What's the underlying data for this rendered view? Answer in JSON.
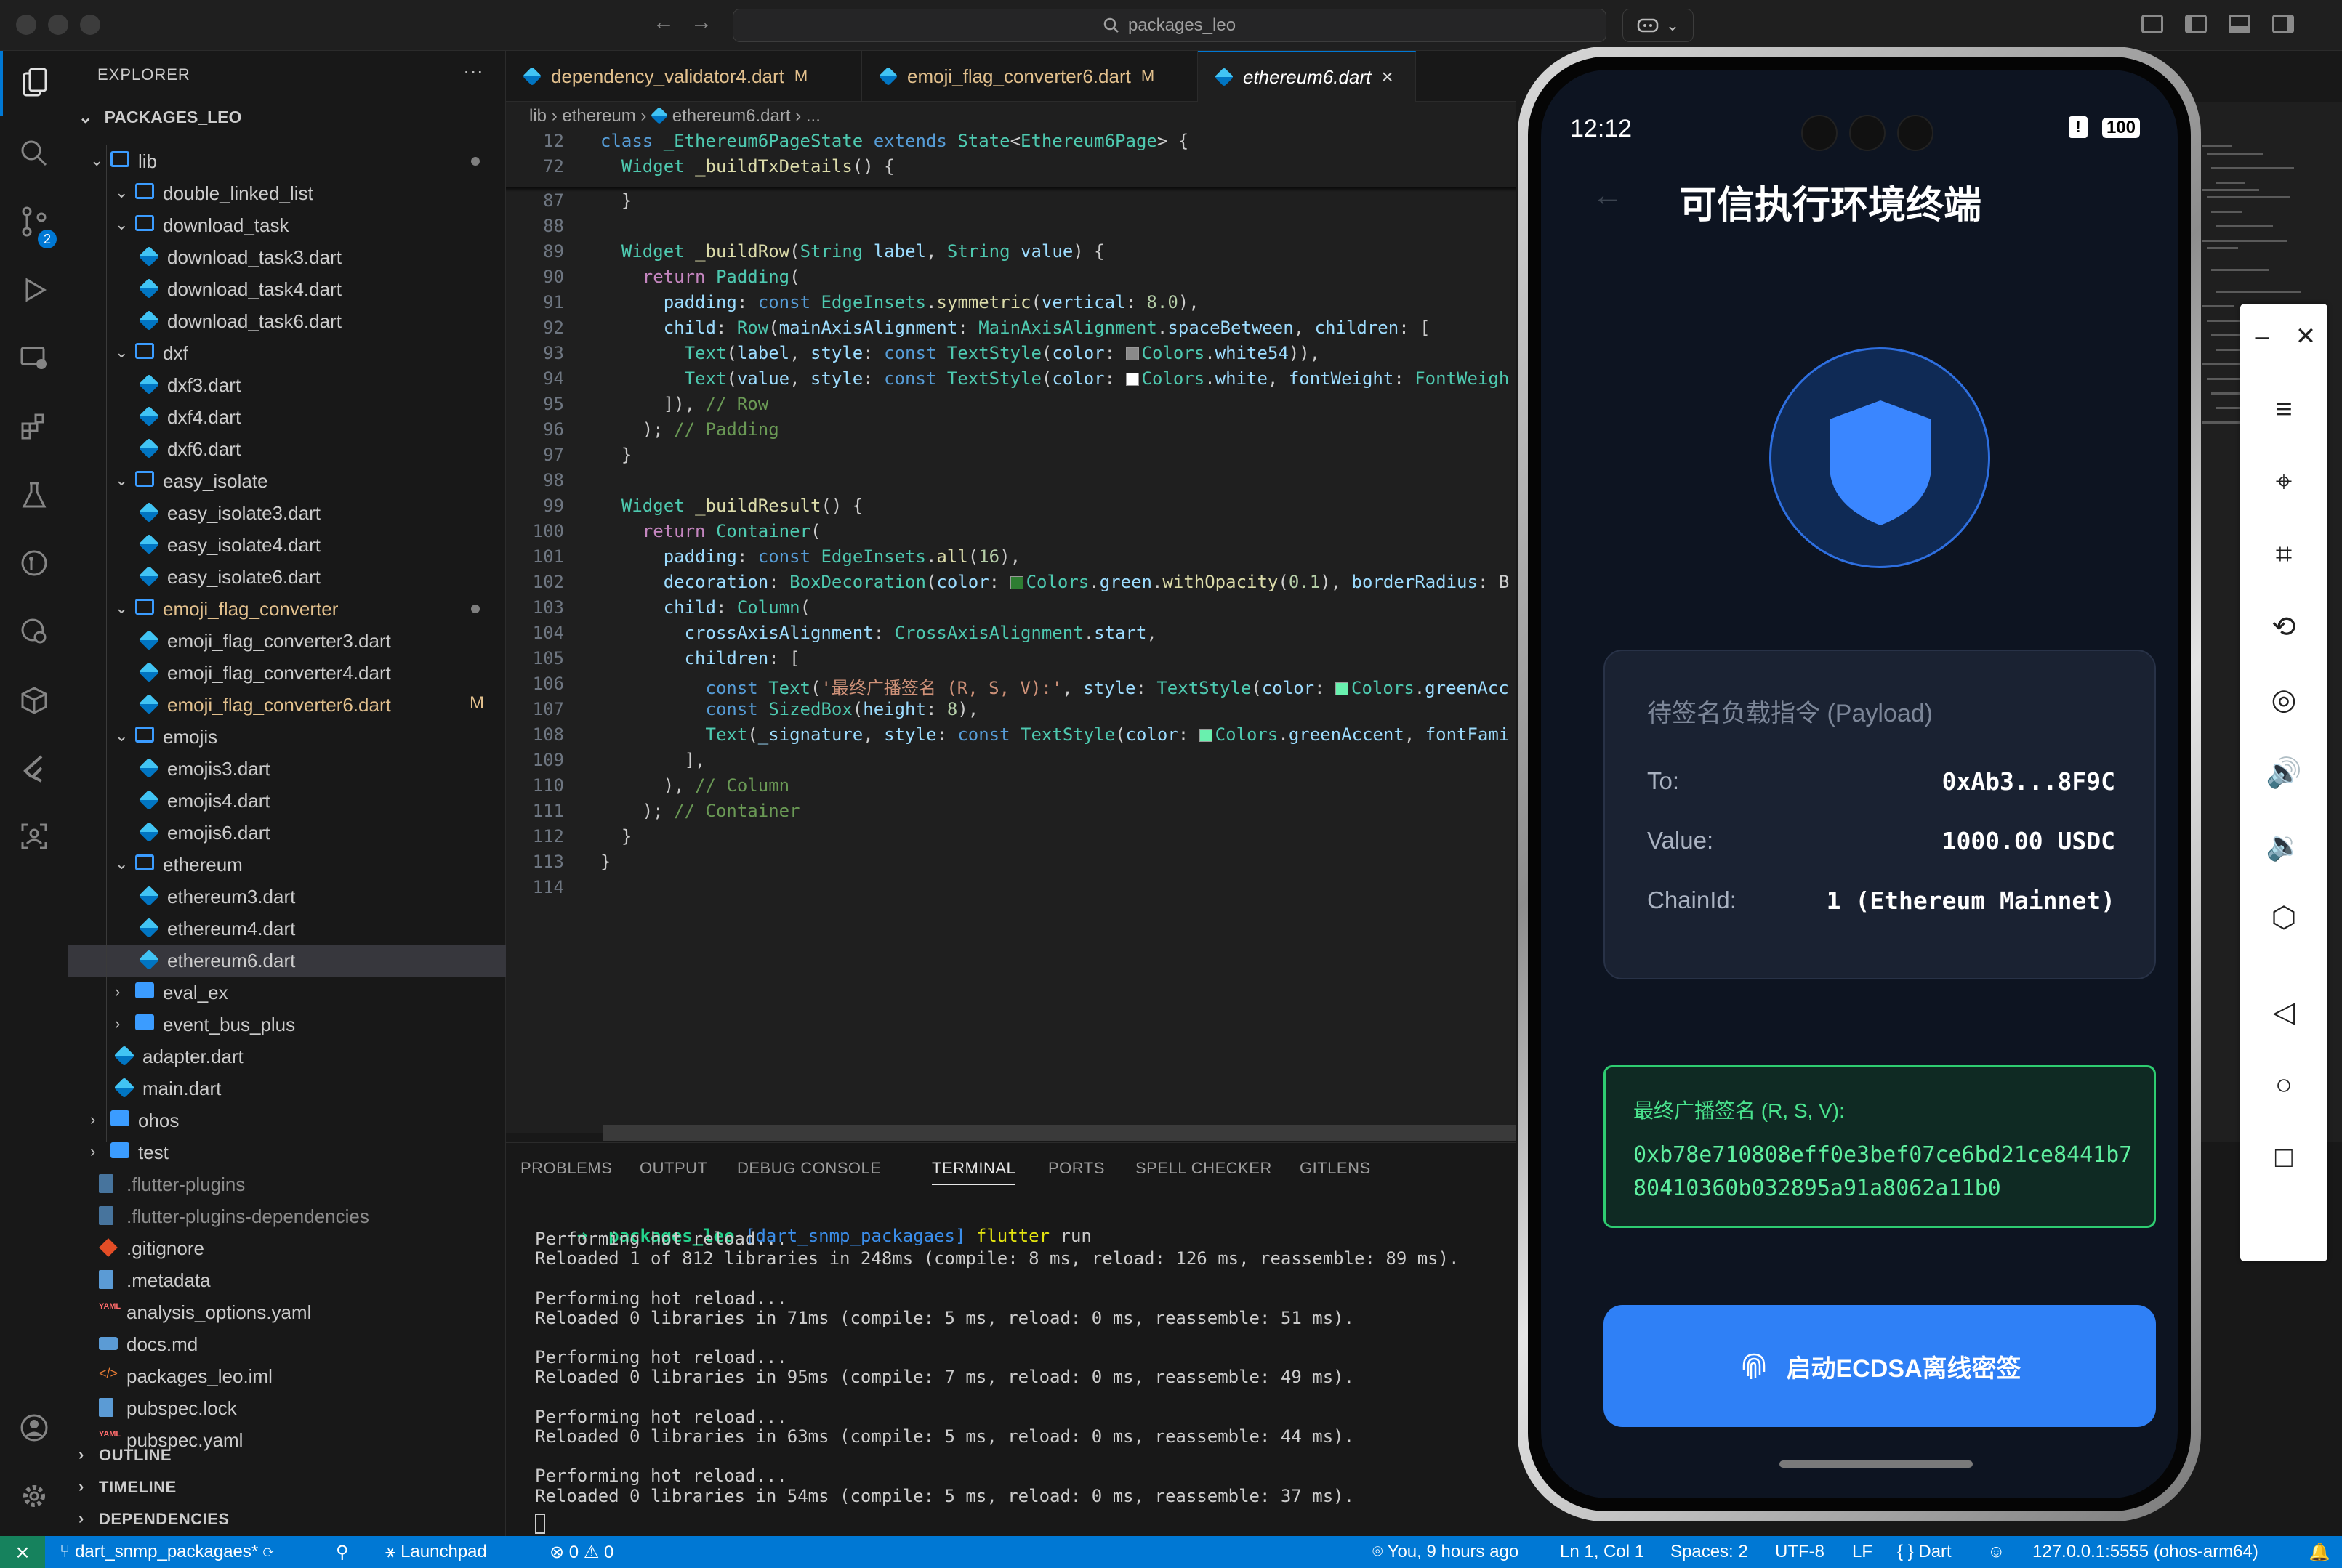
{
  "titlebar": {
    "search_text": "packages_leo",
    "back_arrow": "←",
    "forward_arrow": "→",
    "copilot_icon": "copilot-icon",
    "copilot_caret": "⌄"
  },
  "activity": {
    "scm_badge": "2"
  },
  "explorer": {
    "title": "EXPLORER",
    "more": "···",
    "root": "PACKAGES_LEO",
    "items": [
      {
        "label": "lib",
        "kind": "folder-open",
        "depth": 0,
        "chev": "⌄",
        "dot": true
      },
      {
        "label": "double_linked_list",
        "kind": "folder",
        "depth": 1,
        "chev": "⌄"
      },
      {
        "label": "download_task",
        "kind": "folder",
        "depth": 1,
        "chev": "⌄"
      },
      {
        "label": "download_task3.dart",
        "kind": "dart",
        "depth": 2
      },
      {
        "label": "download_task4.dart",
        "kind": "dart",
        "depth": 2
      },
      {
        "label": "download_task6.dart",
        "kind": "dart",
        "depth": 2
      },
      {
        "label": "dxf",
        "kind": "folder",
        "depth": 1,
        "chev": "⌄"
      },
      {
        "label": "dxf3.dart",
        "kind": "dart",
        "depth": 2
      },
      {
        "label": "dxf4.dart",
        "kind": "dart",
        "depth": 2
      },
      {
        "label": "dxf6.dart",
        "kind": "dart",
        "depth": 2
      },
      {
        "label": "easy_isolate",
        "kind": "folder",
        "depth": 1,
        "chev": "⌄"
      },
      {
        "label": "easy_isolate3.dart",
        "kind": "dart",
        "depth": 2
      },
      {
        "label": "easy_isolate4.dart",
        "kind": "dart",
        "depth": 2
      },
      {
        "label": "easy_isolate6.dart",
        "kind": "dart",
        "depth": 2
      },
      {
        "label": "emoji_flag_converter",
        "kind": "folder",
        "depth": 1,
        "chev": "⌄",
        "modified": true,
        "dot": true
      },
      {
        "label": "emoji_flag_converter3.dart",
        "kind": "dart",
        "depth": 2
      },
      {
        "label": "emoji_flag_converter4.dart",
        "kind": "dart",
        "depth": 2
      },
      {
        "label": "emoji_flag_converter6.dart",
        "kind": "dart",
        "depth": 2,
        "modified": true,
        "deco": "M"
      },
      {
        "label": "emojis",
        "kind": "folder",
        "depth": 1,
        "chev": "⌄"
      },
      {
        "label": "emojis3.dart",
        "kind": "dart",
        "depth": 2
      },
      {
        "label": "emojis4.dart",
        "kind": "dart",
        "depth": 2
      },
      {
        "label": "emojis6.dart",
        "kind": "dart",
        "depth": 2
      },
      {
        "label": "ethereum",
        "kind": "folder",
        "depth": 1,
        "chev": "⌄"
      },
      {
        "label": "ethereum3.dart",
        "kind": "dart",
        "depth": 2
      },
      {
        "label": "ethereum4.dart",
        "kind": "dart",
        "depth": 2
      },
      {
        "label": "ethereum6.dart",
        "kind": "dart",
        "depth": 2,
        "selected": true
      },
      {
        "label": "eval_ex",
        "kind": "folder-solid",
        "depth": 1,
        "chev": "›"
      },
      {
        "label": "event_bus_plus",
        "kind": "folder-solid",
        "depth": 1,
        "chev": "›"
      },
      {
        "label": "adapter.dart",
        "kind": "dart",
        "depth": 1
      },
      {
        "label": "main.dart",
        "kind": "dart",
        "depth": 1
      },
      {
        "label": "ohos",
        "kind": "folder-solid",
        "depth": 0,
        "chev": "›"
      },
      {
        "label": "test",
        "kind": "folder-solid",
        "depth": 0,
        "chev": "›"
      },
      {
        "label": ".flutter-plugins",
        "kind": "file-dim",
        "depth": 0
      },
      {
        "label": ".flutter-plugins-dependencies",
        "kind": "file-dim",
        "depth": 0
      },
      {
        "label": ".gitignore",
        "kind": "git",
        "depth": 0
      },
      {
        "label": ".metadata",
        "kind": "file",
        "depth": 0
      },
      {
        "label": "analysis_options.yaml",
        "kind": "yaml",
        "depth": 0
      },
      {
        "label": "docs.md",
        "kind": "md",
        "depth": 0
      },
      {
        "label": "packages_leo.iml",
        "kind": "xml",
        "depth": 0
      },
      {
        "label": "pubspec.lock",
        "kind": "file",
        "depth": 0
      },
      {
        "label": "pubspec.yaml",
        "kind": "yaml",
        "depth": 0
      }
    ],
    "sections": [
      "OUTLINE",
      "TIMELINE",
      "DEPENDENCIES"
    ]
  },
  "tabs": [
    {
      "label": "dependency_validator4.dart",
      "badge": "M",
      "active": false
    },
    {
      "label": "emoji_flag_converter6.dart",
      "badge": "M",
      "active": false
    },
    {
      "label": "ethereum6.dart",
      "badge": "×",
      "active": true
    }
  ],
  "breadcrumb": {
    "parts": [
      "lib",
      "›",
      "ethereum",
      "›",
      "ethereum6.dart",
      "›",
      "..."
    ]
  },
  "code": {
    "sticky": [
      {
        "ln": "12",
        "html": "<span class='kw'>class</span> <span class='cls'>_Ethereum6PageState</span> <span class='kw'>extends</span> <span class='cls'>State</span>&lt;<span class='cls'>Ethereum6Page</span>&gt; {"
      },
      {
        "ln": "72",
        "html": "  <span class='cls'>Widget</span> <span class='fn'>_buildTxDetails</span>() {"
      }
    ],
    "lines": [
      {
        "ln": "87",
        "html": "  }"
      },
      {
        "ln": "88",
        "html": ""
      },
      {
        "ln": "89",
        "html": "  <span class='cls'>Widget</span> <span class='fn'>_buildRow</span>(<span class='cls'>String</span> <span class='prop'>label</span>, <span class='cls'>String</span> <span class='prop'>value</span>) {"
      },
      {
        "ln": "90",
        "html": "    <span class='ctl'>return</span> <span class='cls'>Padding</span>("
      },
      {
        "ln": "91",
        "html": "      <span class='prop'>padding</span>: <span class='kw'>const</span> <span class='cls'>EdgeInsets</span>.<span class='fn'>symmetric</span>(<span class='prop'>vertical</span>: <span class='num'>8.0</span>),"
      },
      {
        "ln": "92",
        "html": "      <span class='prop'>child</span>: <span class='cls'>Row</span>(<span class='prop'>mainAxisAlignment</span>: <span class='cls'>MainAxisAlignment</span>.<span class='prop'>spaceBetween</span>, <span class='prop'>children</span>: ["
      },
      {
        "ln": "93",
        "html": "        <span class='cls'>Text</span>(<span class='prop'>label</span>, <span class='prop'>style</span>: <span class='kw'>const</span> <span class='cls'>TextStyle</span>(<span class='prop'>color</span>: <span class='sw' style='background:#8a8a8a'></span><span class='cls'>Colors</span>.<span class='prop'>white54</span>)),"
      },
      {
        "ln": "94",
        "html": "        <span class='cls'>Text</span>(<span class='prop'>value</span>, <span class='prop'>style</span>: <span class='kw'>const</span> <span class='cls'>TextStyle</span>(<span class='prop'>color</span>: <span class='sw' style='background:#ffffff'></span><span class='cls'>Colors</span>.<span class='prop'>white</span>, <span class='prop'>fontWeight</span>: <span class='cls'>FontWeigh</span>"
      },
      {
        "ln": "95",
        "html": "      ]), <span class='cmt'>// Row</span>"
      },
      {
        "ln": "96",
        "html": "    ); <span class='cmt'>// Padding</span>"
      },
      {
        "ln": "97",
        "html": "  }"
      },
      {
        "ln": "98",
        "html": ""
      },
      {
        "ln": "99",
        "html": "  <span class='cls'>Widget</span> <span class='fn'>_buildResult</span>() {"
      },
      {
        "ln": "100",
        "html": "    <span class='ctl'>return</span> <span class='cls'>Container</span>("
      },
      {
        "ln": "101",
        "html": "      <span class='prop'>padding</span>: <span class='kw'>const</span> <span class='cls'>EdgeInsets</span>.<span class='fn'>all</span>(<span class='num'>16</span>),"
      },
      {
        "ln": "102",
        "html": "      <span class='prop'>decoration</span>: <span class='cls'>BoxDecoration</span>(<span class='prop'>color</span>: <span class='sw' style='background:#2e7d32'></span><span class='cls'>Colors</span>.<span class='prop'>green</span>.<span class='fn'>withOpacity</span>(<span class='num'>0.1</span>), <span class='prop'>borderRadius</span>: B"
      },
      {
        "ln": "103",
        "html": "      <span class='prop'>child</span>: <span class='cls'>Column</span>("
      },
      {
        "ln": "104",
        "html": "        <span class='prop'>crossAxisAlignment</span>: <span class='cls'>CrossAxisAlignment</span>.<span class='prop'>start</span>,"
      },
      {
        "ln": "105",
        "html": "        <span class='prop'>children</span>: ["
      },
      {
        "ln": "106",
        "html": "          <span class='kw'>const</span> <span class='cls'>Text</span>(<span class='str'>'最终广播签名 (R, S, V):'</span>, <span class='prop'>style</span>: <span class='cls'>TextStyle</span>(<span class='prop'>color</span>: <span class='sw' style='background:#69f0ae'></span><span class='cls'>Colors</span>.<span class='prop'>greenAcc</span>"
      },
      {
        "ln": "107",
        "html": "          <span class='kw'>const</span> <span class='cls'>SizedBox</span>(<span class='prop'>height</span>: <span class='num'>8</span>),"
      },
      {
        "ln": "108",
        "html": "          <span class='cls'>Text</span>(<span class='prop'>_signature</span>, <span class='prop'>style</span>: <span class='kw'>const</span> <span class='cls'>TextStyle</span>(<span class='prop'>color</span>: <span class='sw' style='background:#69f0ae'></span><span class='cls'>Colors</span>.<span class='prop'>greenAccent</span>, <span class='prop'>fontFami</span>"
      },
      {
        "ln": "109",
        "html": "        ],"
      },
      {
        "ln": "110",
        "html": "      ), <span class='cmt'>// Column</span>"
      },
      {
        "ln": "111",
        "html": "    ); <span class='cmt'>// Container</span>"
      },
      {
        "ln": "112",
        "html": "  }"
      },
      {
        "ln": "113",
        "html": "}"
      },
      {
        "ln": "114",
        "html": ""
      }
    ]
  },
  "panel": {
    "tabs": [
      "PROBLEMS",
      "OUTPUT",
      "DEBUG CONSOLE",
      "TERMINAL",
      "PORTS",
      "SPELL CHECKER",
      "GITLENS"
    ],
    "active_tab": "TERMINAL",
    "more": "···",
    "prompt_arrow": "➜",
    "prompt_path": "packages_leo",
    "prompt_branch": "[dart_snmp_packagaes]",
    "prompt_cmd": "flutter",
    "prompt_arg": "run",
    "output": [
      "Performing hot reload...",
      "Reloaded 1 of 812 libraries in 248ms (compile: 8 ms, reload: 126 ms, reassemble: 89 ms).",
      "",
      "Performing hot reload...",
      "Reloaded 0 libraries in 71ms (compile: 5 ms, reload: 0 ms, reassemble: 51 ms).",
      "",
      "Performing hot reload...",
      "Reloaded 0 libraries in 95ms (compile: 7 ms, reload: 0 ms, reassemble: 49 ms).",
      "",
      "Performing hot reload...",
      "Reloaded 0 libraries in 63ms (compile: 5 ms, reload: 0 ms, reassemble: 44 ms).",
      "",
      "Performing hot reload...",
      "Reloaded 0 libraries in 54ms (compile: 5 ms, reload: 0 ms, reassemble: 37 ms)."
    ]
  },
  "phone": {
    "time": "12:12",
    "battery": "100",
    "alert": "!",
    "back": "←",
    "title": "可信执行环境终端",
    "payload_title": "待签名负载指令 (Payload)",
    "rows": [
      {
        "key": "To:",
        "value": "0xAb3...8F9C"
      },
      {
        "key": "Value:",
        "value": "1000.00 USDC"
      },
      {
        "key": "ChainId:",
        "value": "1 (Ethereum Mainnet)"
      }
    ],
    "sig_title": "最终广播签名 (R, S, V):",
    "sig_value": "0xb78e710808eff0e3bef07ce6bd21ce8441b780410360b032895a91a8062a11b0",
    "button_label": "启动ECDSA离线密签",
    "colors": {
      "accent": "#2f80f6",
      "sig_green": "#5ef0a0",
      "background": "#0d1421"
    }
  },
  "emulator_toolbar": {
    "minimize": "–",
    "close": "✕",
    "buttons": [
      "≡",
      "⌖",
      "⌗",
      "⟲",
      "◎",
      "🔊",
      "🔉",
      "⬡",
      "◁",
      "○",
      "□"
    ]
  },
  "statusbar": {
    "remote": "⨯",
    "branch": "dart_snmp_packagaes*",
    "launchpad": "Launchpad",
    "errors": "0",
    "warnings": "0",
    "blame": "You, 9 hours ago",
    "position": "Ln 1, Col 1",
    "spaces": "Spaces: 2",
    "encoding": "UTF-8",
    "eol": "LF",
    "language": "Dart",
    "device": "127.0.0.1:5555 (ohos-arm64)",
    "bell": "🔔"
  }
}
